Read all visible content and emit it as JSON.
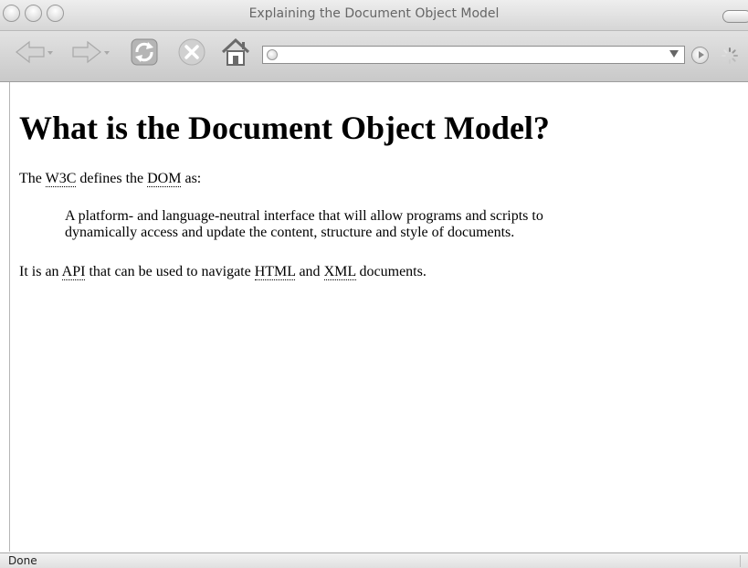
{
  "window": {
    "title": "Explaining the Document Object Model"
  },
  "toolbar": {
    "back_icon": "back-arrow-icon",
    "forward_icon": "forward-arrow-icon",
    "reload_icon": "reload-icon",
    "stop_icon": "stop-icon",
    "home_icon": "home-icon",
    "address": {
      "value": "",
      "placeholder": ""
    }
  },
  "page": {
    "heading": "What is the Document Object Model?",
    "intro": {
      "before_w3c": "The ",
      "w3c": "W3C",
      "between": " defines the ",
      "dom": "DOM",
      "after": " as:"
    },
    "quote": {
      "line1": "A platform- and language-neutral interface that will allow programs and scripts to",
      "line2": "dynamically access and update the content, structure and style of documents."
    },
    "api_para": {
      "before_api": "It is an ",
      "api": "API",
      "middle": " that can be used to navigate ",
      "html": "HTML",
      "and": " and ",
      "xml": "XML",
      "after": " documents."
    }
  },
  "statusbar": {
    "text": "Done"
  },
  "colors": {
    "chrome_light": "#e2e2e2",
    "chrome_dark": "#c9c9c9",
    "icon_gray": "#9a9a9a",
    "text": "#000000"
  }
}
